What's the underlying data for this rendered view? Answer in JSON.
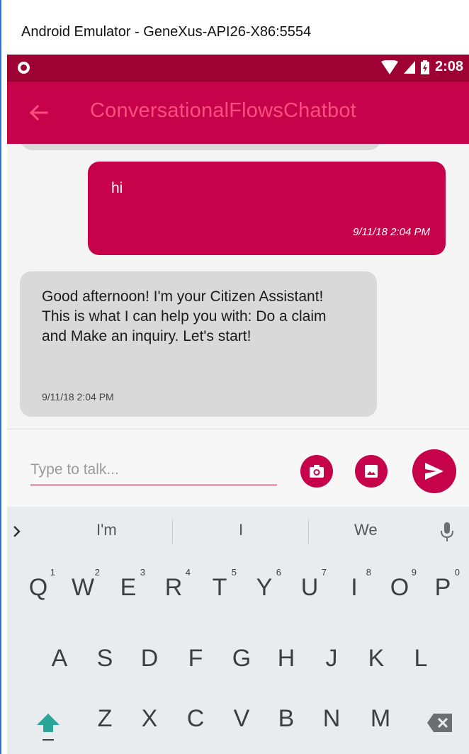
{
  "window": {
    "title": "Android Emulator - GeneXus-API26-X86:5554"
  },
  "status_bar": {
    "time": "2:08",
    "icons": [
      "notification-circle-icon",
      "wifi-icon",
      "signal-icon",
      "battery-icon"
    ]
  },
  "app_bar": {
    "title": "ConversationalFlowsChatbot",
    "back_icon": "arrow-back-icon"
  },
  "chat": {
    "messages": [
      {
        "from": "user",
        "text": "hi",
        "time": "9/11/18 2:04 PM"
      },
      {
        "from": "bot",
        "text": "Good afternoon! I'm your Citizen Assistant! This is what I can help you with: Do a claim and Make an inquiry. Let's start!",
        "time": "9/11/18 2:04 PM"
      }
    ]
  },
  "compose": {
    "placeholder": "Type to talk...",
    "value": "",
    "buttons": [
      "camera-icon",
      "image-icon",
      "send-icon"
    ]
  },
  "keyboard": {
    "suggestions": [
      "I'm",
      "I",
      "We"
    ],
    "row1": [
      {
        "key": "Q",
        "sup": "1"
      },
      {
        "key": "W",
        "sup": "2"
      },
      {
        "key": "E",
        "sup": "3"
      },
      {
        "key": "R",
        "sup": "4"
      },
      {
        "key": "T",
        "sup": "5"
      },
      {
        "key": "Y",
        "sup": "6"
      },
      {
        "key": "U",
        "sup": "7"
      },
      {
        "key": "I",
        "sup": "8"
      },
      {
        "key": "O",
        "sup": "9"
      },
      {
        "key": "P",
        "sup": "0"
      }
    ],
    "row2": [
      "A",
      "S",
      "D",
      "F",
      "G",
      "H",
      "J",
      "K",
      "L"
    ],
    "row3": [
      "Z",
      "X",
      "C",
      "V",
      "B",
      "N",
      "M"
    ]
  },
  "colors": {
    "primary": "#c5024a",
    "primary_dark": "#9d0232",
    "title_accent": "#ff4f7f",
    "bot_bubble": "#d9d9d9"
  }
}
